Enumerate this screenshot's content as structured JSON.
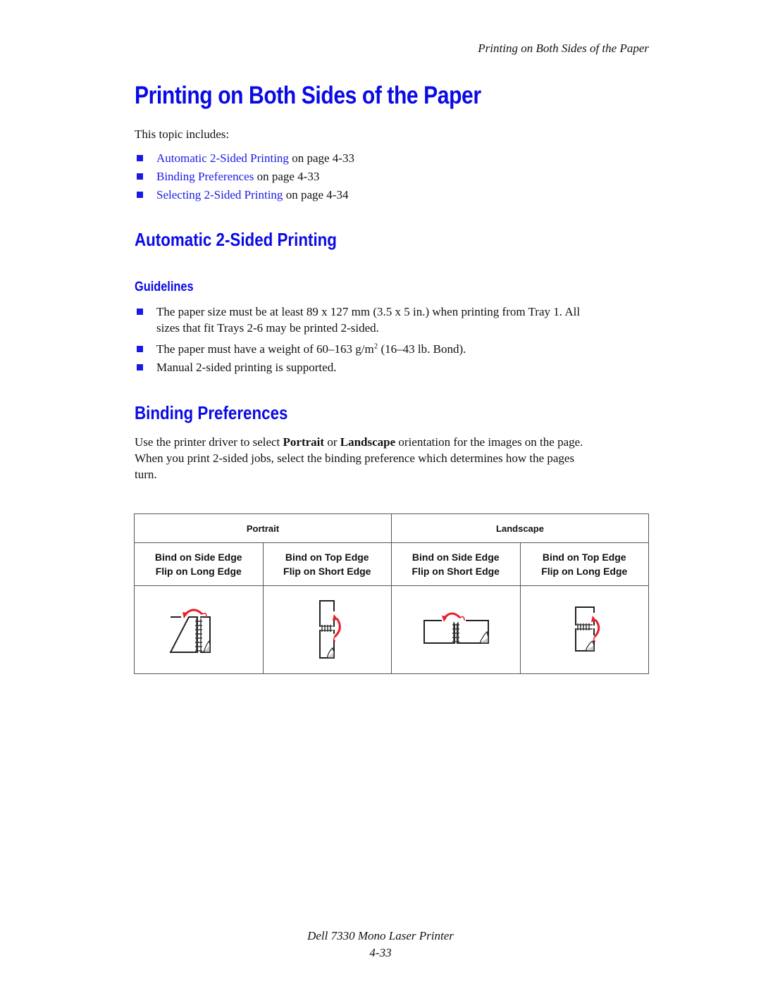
{
  "running_head": "Printing on Both Sides of the Paper",
  "title": "Printing on Both Sides of the Paper",
  "intro": "This topic includes:",
  "toc": [
    {
      "link": "Automatic 2-Sided Printing",
      "suffix": " on page 4-33"
    },
    {
      "link": "Binding Preferences",
      "suffix": " on page 4-33"
    },
    {
      "link": "Selecting 2-Sided Printing",
      "suffix": " on page 4-34"
    }
  ],
  "section1": {
    "heading": "Automatic 2-Sided Printing",
    "subheading": "Guidelines",
    "bullets": {
      "b1_line1": "The paper size must be at least 89 x 127 mm (3.5 x 5 in.) when printing from Tray 1. All",
      "b1_line2": "sizes that fit Trays 2-6 may be printed 2-sided.",
      "b2_pre": "The paper must have a weight of 60–163 g/m",
      "b2_sup": "2",
      "b2_post": " (16–43 lb. Bond).",
      "b3": "Manual 2-sided printing is supported."
    }
  },
  "section2": {
    "heading": "Binding Preferences",
    "para": {
      "p1": "Use the printer driver to select ",
      "bold1": "Portrait",
      "p2": " or ",
      "bold2": "Landscape",
      "p3": " orientation for the images on the page.",
      "line2": "When you print 2-sided jobs, select the binding preference which determines how the pages",
      "line3": "turn."
    },
    "table": {
      "groups": [
        "Portrait",
        "Landscape"
      ],
      "columns": [
        {
          "bind": "Bind on Side Edge",
          "flip": "Flip on Long Edge",
          "icon": "portrait-side-bind-icon"
        },
        {
          "bind": "Bind on Top Edge",
          "flip": "Flip on Short Edge",
          "icon": "portrait-top-bind-icon"
        },
        {
          "bind": "Bind on Side Edge",
          "flip": "Flip on Short Edge",
          "icon": "landscape-side-bind-icon"
        },
        {
          "bind": "Bind on Top Edge",
          "flip": "Flip on Long Edge",
          "icon": "landscape-top-bind-icon"
        }
      ]
    }
  },
  "footer": {
    "product": "Dell 7330 Mono Laser Printer",
    "page": "4-33"
  },
  "colors": {
    "heading": "#0a0ae6",
    "link": "#1a1ae6",
    "arrow": "#e8202a"
  }
}
